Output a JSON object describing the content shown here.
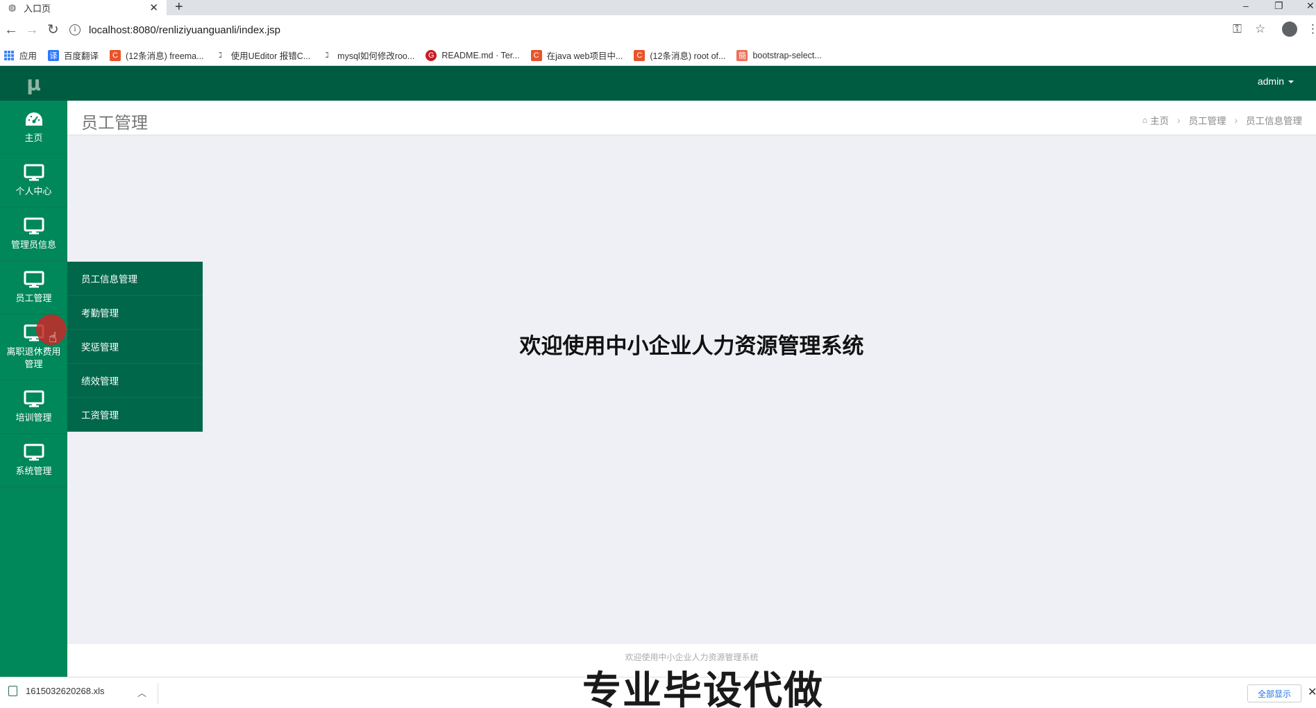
{
  "browser": {
    "tab_title": "入口页",
    "url": "localhost:8080/renliziyuanguanli/index.jsp",
    "bookmarks": [
      {
        "label": "应用",
        "icon": "apps-icon",
        "color": "#4285f4"
      },
      {
        "label": "百度翻译",
        "icon": "baidu-translate-icon",
        "color": "#2f7bff"
      },
      {
        "label": "(12条消息) freema...",
        "icon": "csdn-icon",
        "color": "#e8542c"
      },
      {
        "label": "使用UEditor 报错C...",
        "icon": "site-icon",
        "color": "#555555"
      },
      {
        "label": "mysql如何修改roo...",
        "icon": "site-icon",
        "color": "#555555"
      },
      {
        "label": "README.md · Ter...",
        "icon": "gitee-icon",
        "color": "#c71d23"
      },
      {
        "label": "在java web项目中...",
        "icon": "csdn-icon",
        "color": "#e8542c"
      },
      {
        "label": "(12条消息) root of...",
        "icon": "csdn-icon",
        "color": "#e8542c"
      },
      {
        "label": "bootstrap-select...",
        "icon": "jianshu-icon",
        "color": "#ea6f5a"
      }
    ]
  },
  "app": {
    "logo": "μ",
    "user": "admin",
    "sidebar": [
      {
        "label": "主页",
        "icon": "dashboard-icon"
      },
      {
        "label": "个人中心",
        "icon": "monitor-icon"
      },
      {
        "label": "管理员信息",
        "icon": "monitor-icon"
      },
      {
        "label": "员工管理",
        "icon": "monitor-icon"
      },
      {
        "label": "离职退休费用管理",
        "icon": "monitor-icon"
      },
      {
        "label": "培训管理",
        "icon": "monitor-icon"
      },
      {
        "label": "系统管理",
        "icon": "monitor-icon"
      }
    ],
    "submenu": [
      "员工信息管理",
      "考勤管理",
      "奖惩管理",
      "绩效管理",
      "工资管理"
    ],
    "page_title": "员工管理",
    "breadcrumb": [
      "主页",
      "员工管理",
      "员工信息管理"
    ],
    "welcome": "欢迎使用中小企业人力资源管理系统",
    "footer": "欢迎使用中小企业人力资源管理系统"
  },
  "downloads": {
    "file": "1615032620268.xls",
    "show_all": "全部显示"
  },
  "watermark": "专业毕设代做",
  "colors": {
    "sidebar": "#00875a",
    "topbar": "#005c41",
    "submenu": "#00674a",
    "content_bg": "#eef0f5"
  }
}
